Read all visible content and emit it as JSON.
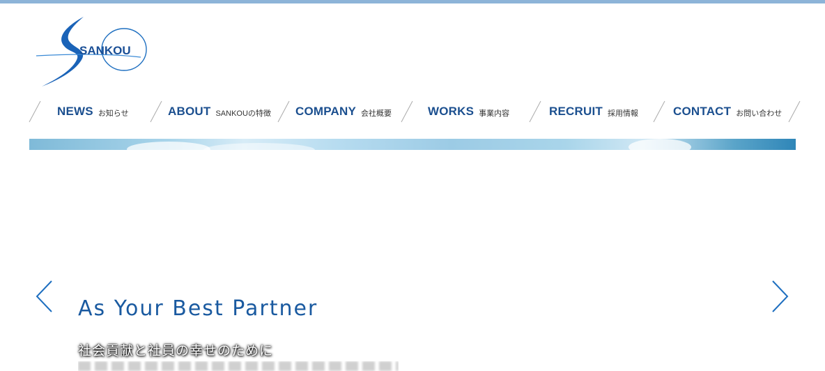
{
  "logo": {
    "text": "SANKOU"
  },
  "nav": {
    "items": [
      {
        "en": "NEWS",
        "ja": "お知らせ"
      },
      {
        "en": "ABOUT",
        "ja": "SANKOUの特徴"
      },
      {
        "en": "COMPANY",
        "ja": "会社概要"
      },
      {
        "en": "WORKS",
        "ja": "事業内容"
      },
      {
        "en": "RECRUIT",
        "ja": "採用情報"
      },
      {
        "en": "CONTACT",
        "ja": "お問い合わせ"
      }
    ]
  },
  "hero": {
    "headline": "As Your Best Partner",
    "subline": "社会貢献と社員の幸せのために"
  },
  "colors": {
    "brand": "#1b4f8f",
    "topbar": "#8db4d8",
    "headline": "#1a5aa0"
  },
  "icons": {
    "prev": "chevron-left-icon",
    "next": "chevron-right-icon"
  }
}
